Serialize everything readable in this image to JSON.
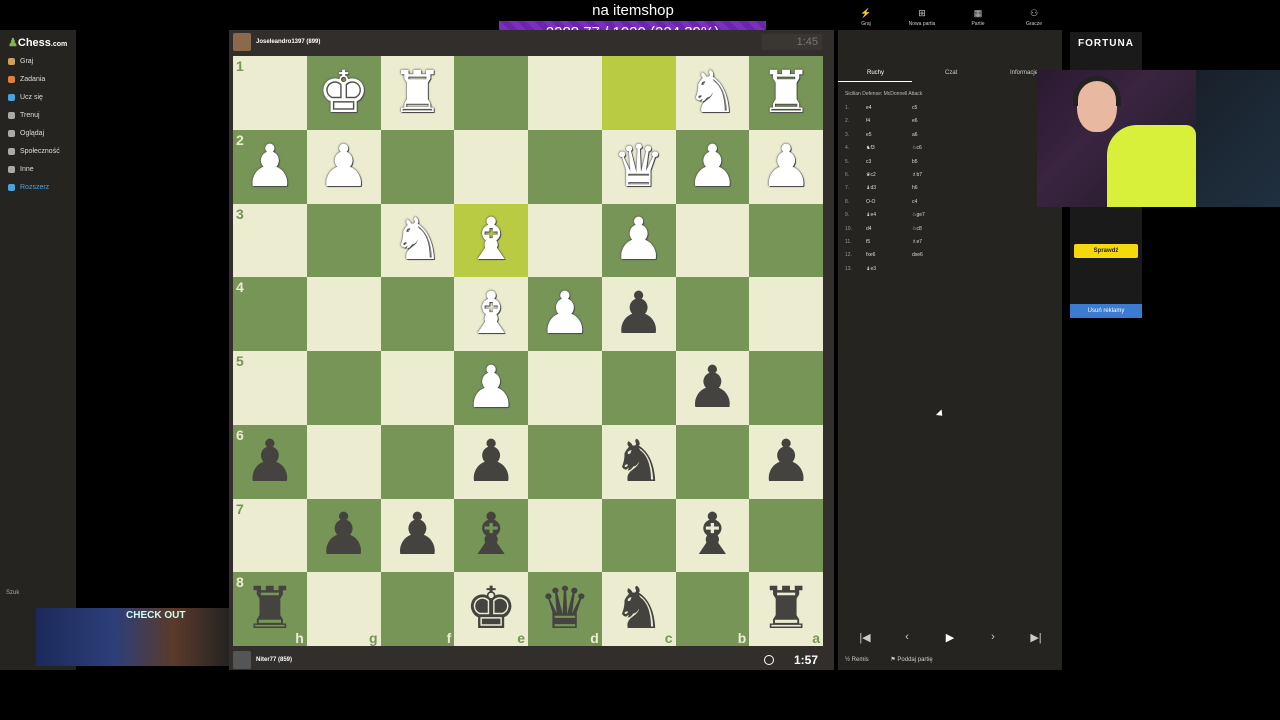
{
  "overlay": {
    "title": "na itemshop",
    "progress": "2288.77 / 1020 (224.39%)"
  },
  "sidebar": {
    "logo_main": "Chess",
    "logo_suffix": ".com",
    "items": [
      {
        "label": "Graj",
        "color": "#cfa15a"
      },
      {
        "label": "Zadania",
        "color": "#e08040"
      },
      {
        "label": "Ucz się",
        "color": "#4aa3df"
      },
      {
        "label": "Trenuj",
        "color": "#aaaaaa"
      },
      {
        "label": "Oglądaj",
        "color": "#aaaaaa"
      },
      {
        "label": "Społeczność",
        "color": "#aaaaaa"
      },
      {
        "label": "Inne",
        "color": "#aaaaaa"
      },
      {
        "label": "Rozszerz",
        "color": "#4aa3df"
      }
    ],
    "search": "Szuk",
    "stream_overlay": "CHECK OUT"
  },
  "top_player": {
    "name": "Joseleandro1397 (899)"
  },
  "bottom_player": {
    "name": "Niter77 (859)"
  },
  "clocks": {
    "top": "1:45",
    "bottom": "1:57"
  },
  "board": {
    "ranks": [
      "1",
      "2",
      "3",
      "4",
      "5",
      "6",
      "7",
      "8"
    ],
    "files": [
      "h",
      "g",
      "f",
      "e",
      "d",
      "c",
      "b",
      "a"
    ],
    "rows": [
      [
        "",
        "wK",
        "wR",
        "",
        "",
        "",
        "wN",
        "wR"
      ],
      [
        "wP",
        "wP",
        "",
        "",
        "",
        "wQ",
        "wP",
        "wP"
      ],
      [
        "",
        "",
        "wN",
        "wB",
        "",
        "wP",
        "",
        ""
      ],
      [
        "",
        "",
        "",
        "wB",
        "wP",
        "bP",
        "",
        ""
      ],
      [
        "",
        "",
        "",
        "wP",
        "",
        "",
        "bP",
        ""
      ],
      [
        "bP",
        "",
        "",
        "bP",
        "",
        "bN",
        "",
        "bP"
      ],
      [
        "",
        "bP",
        "bP",
        "bB",
        "",
        "",
        "bB",
        ""
      ],
      [
        "bR",
        "",
        "",
        "bK",
        "bQ",
        "bN",
        "",
        "bR"
      ]
    ],
    "highlights": [
      [
        0,
        5
      ],
      [
        2,
        3
      ]
    ],
    "colors": {
      "light": "#ebecd0",
      "dark": "#779556"
    }
  },
  "right_panel": {
    "top_icons": [
      {
        "icon": "lightning-icon",
        "label": "Graj"
      },
      {
        "icon": "plus-icon",
        "label": "Nowa partia"
      },
      {
        "icon": "grid-icon",
        "label": "Partie"
      },
      {
        "icon": "players-icon",
        "label": "Gracze"
      }
    ],
    "tabs": [
      "Ruchy",
      "Czat",
      "Informacje"
    ],
    "opening": "Sicilian Defense: McDonnell Attack",
    "moves": [
      {
        "n": "1.",
        "w": "e4",
        "b": "c5"
      },
      {
        "n": "2.",
        "w": "f4",
        "b": "e6"
      },
      {
        "n": "3.",
        "w": "e5",
        "b": "a6"
      },
      {
        "n": "4.",
        "w": "♞f3",
        "b": "♘c6"
      },
      {
        "n": "5.",
        "w": "c3",
        "b": "b5"
      },
      {
        "n": "6.",
        "w": "♛c2",
        "b": "♗b7"
      },
      {
        "n": "7.",
        "w": "♝d3",
        "b": "h6"
      },
      {
        "n": "8.",
        "w": "O-O",
        "b": "c4"
      },
      {
        "n": "9.",
        "w": "♝e4",
        "b": "♘ge7"
      },
      {
        "n": "10.",
        "w": "d4",
        "b": "♘c8"
      },
      {
        "n": "11.",
        "w": "f5",
        "b": "♗e7"
      },
      {
        "n": "12.",
        "w": "fxe6",
        "b": "dxe6"
      },
      {
        "n": "13.",
        "w": "♝e3",
        "b": ""
      }
    ],
    "footer": {
      "draw": "Remis",
      "resign": "Poddaj partię"
    }
  },
  "ad": {
    "brand": "FORTUNA",
    "button": "Sprawdź",
    "remove": "Usuń reklamy"
  }
}
